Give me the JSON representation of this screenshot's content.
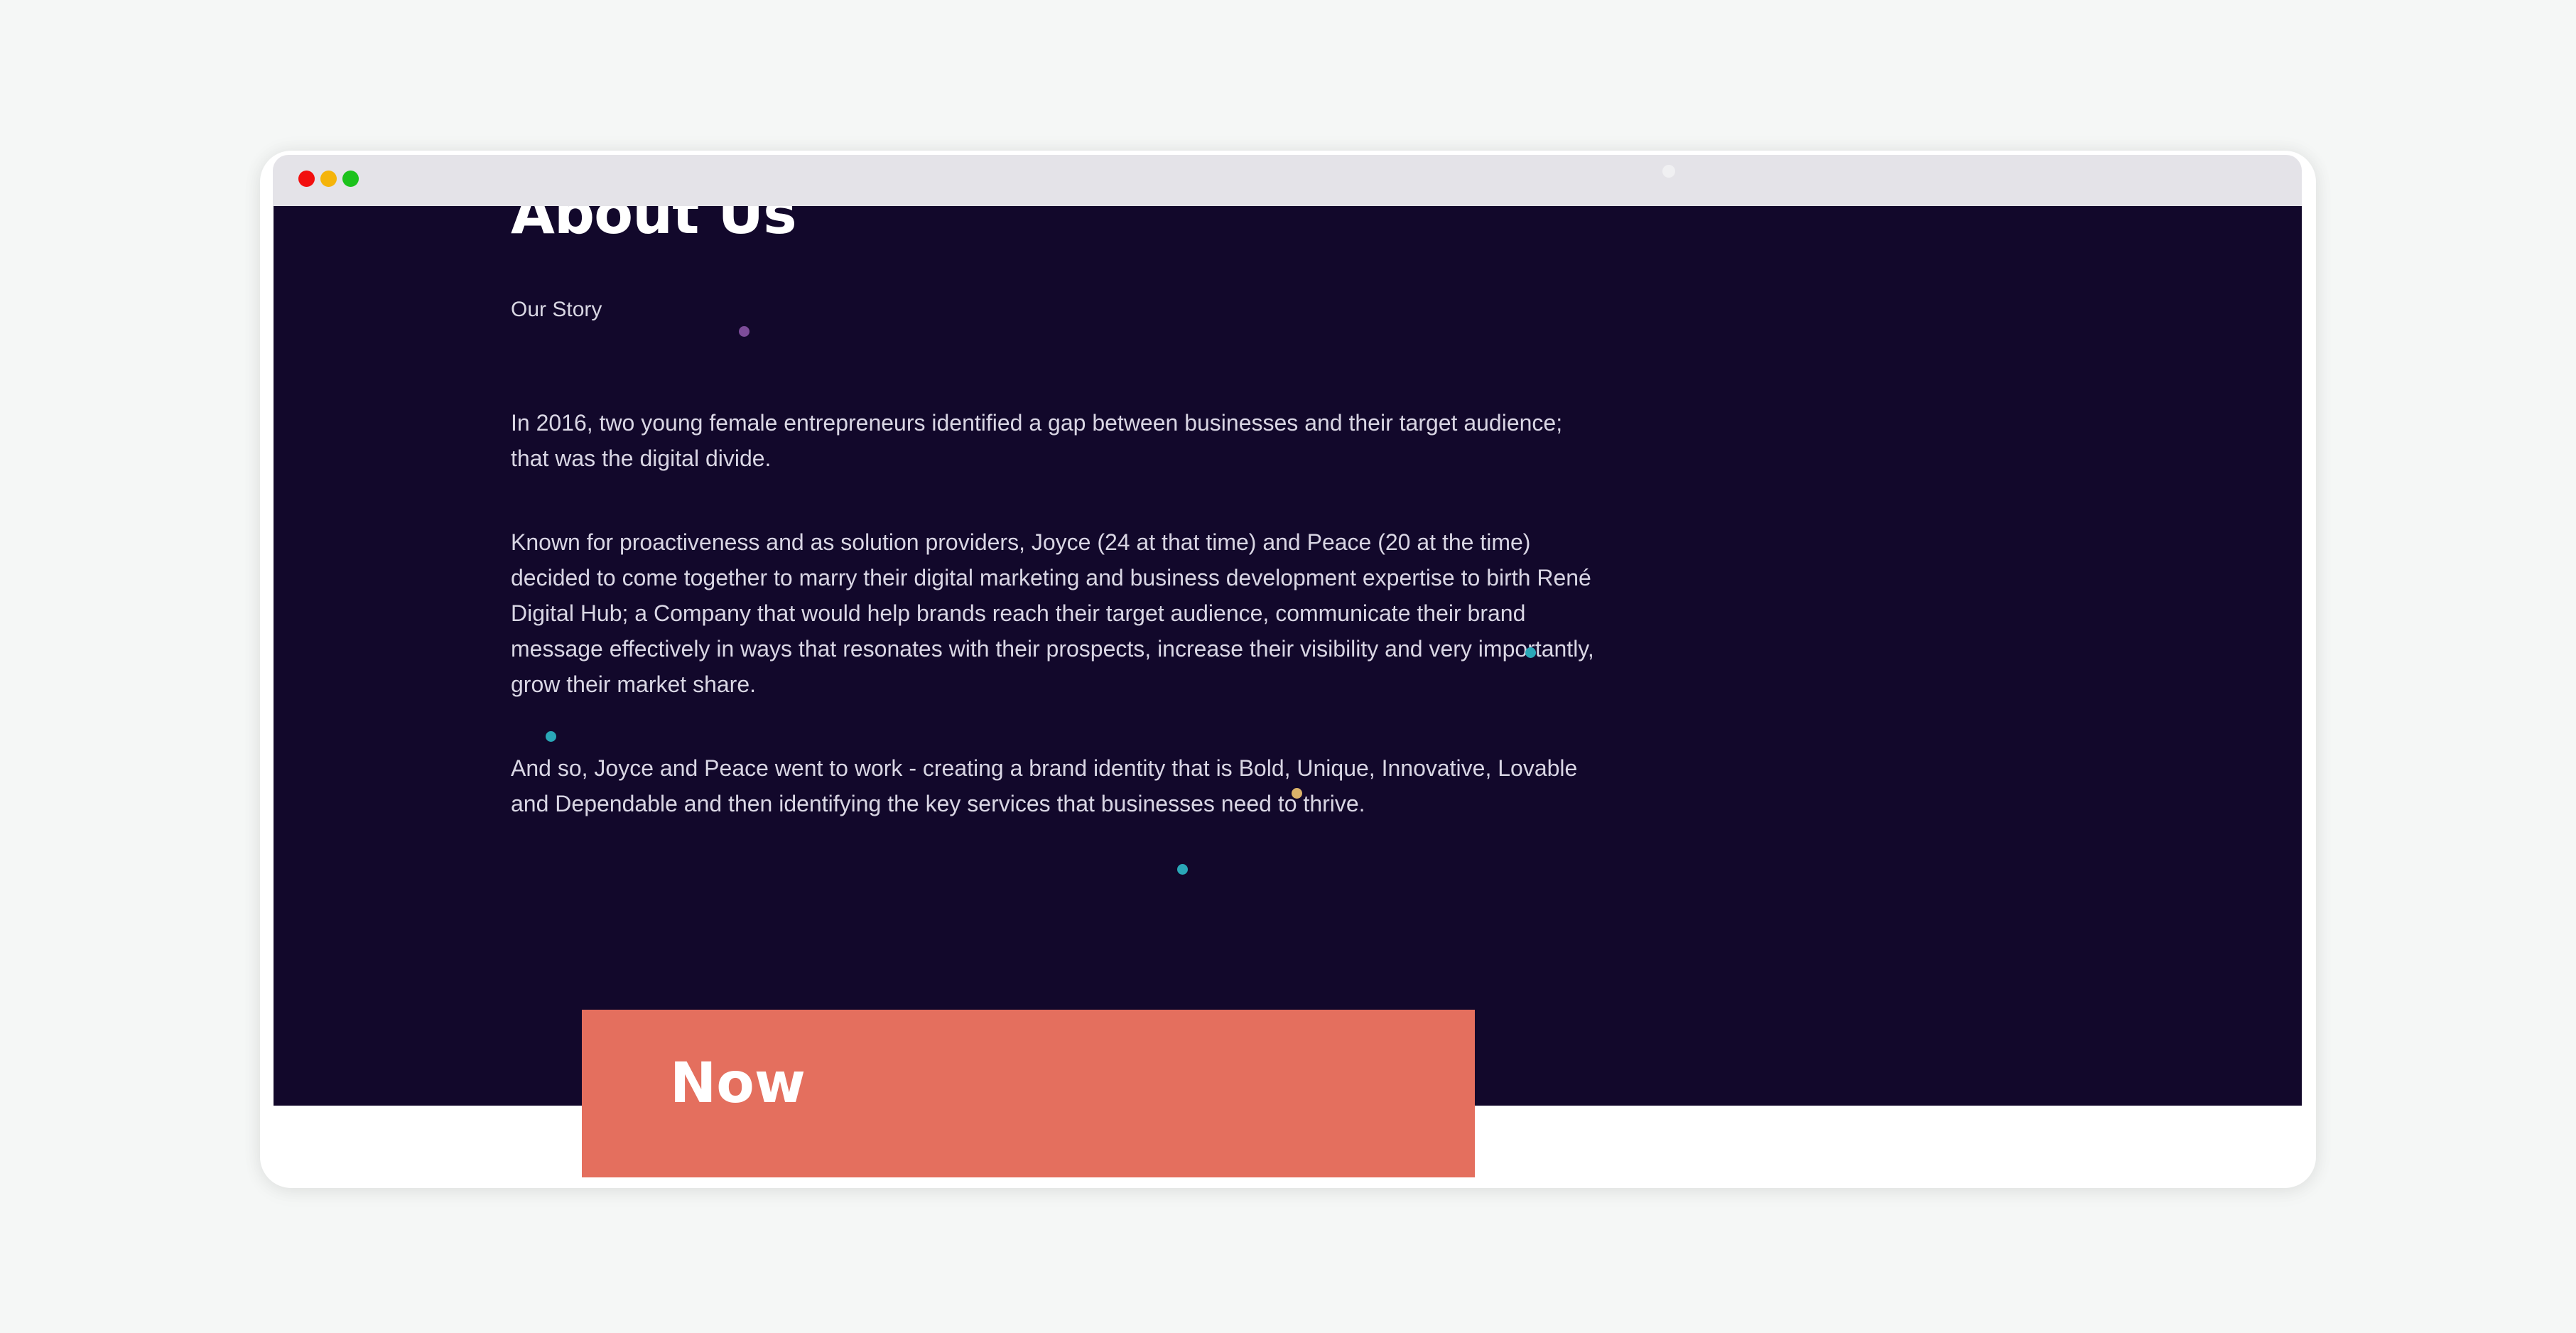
{
  "window": {
    "controls": [
      "close",
      "minimize",
      "zoom"
    ],
    "colors": {
      "close": "#f20f0f",
      "minimize": "#f5b40a",
      "zoom": "#1cc21c",
      "titlebar": "#e4e3e8",
      "page_background": "#12082b",
      "card_accent": "#e46f5e"
    }
  },
  "about": {
    "title": "About Us",
    "subtitle": "Our Story",
    "paragraphs": [
      "In 2016, two young female entrepreneurs identified a gap between businesses and their target audience; that was the digital divide.",
      "Known for proactiveness and as solution providers, Joyce (24 at that time) and Peace (20 at the time) decided to come together to marry their digital marketing and business development expertise to birth René Digital Hub; a Company that would help brands reach their target audience, communicate their brand message effectively in ways that resonates with their prospects, increase their visibility and very importantly, grow their market share.",
      "And so, Joyce and Peace went to work - creating a brand identity that is Bold, Unique, Innovative, Lovable and Dependable and then identifying the key services that businesses need to thrive."
    ]
  },
  "now_section": {
    "title": "Now"
  }
}
